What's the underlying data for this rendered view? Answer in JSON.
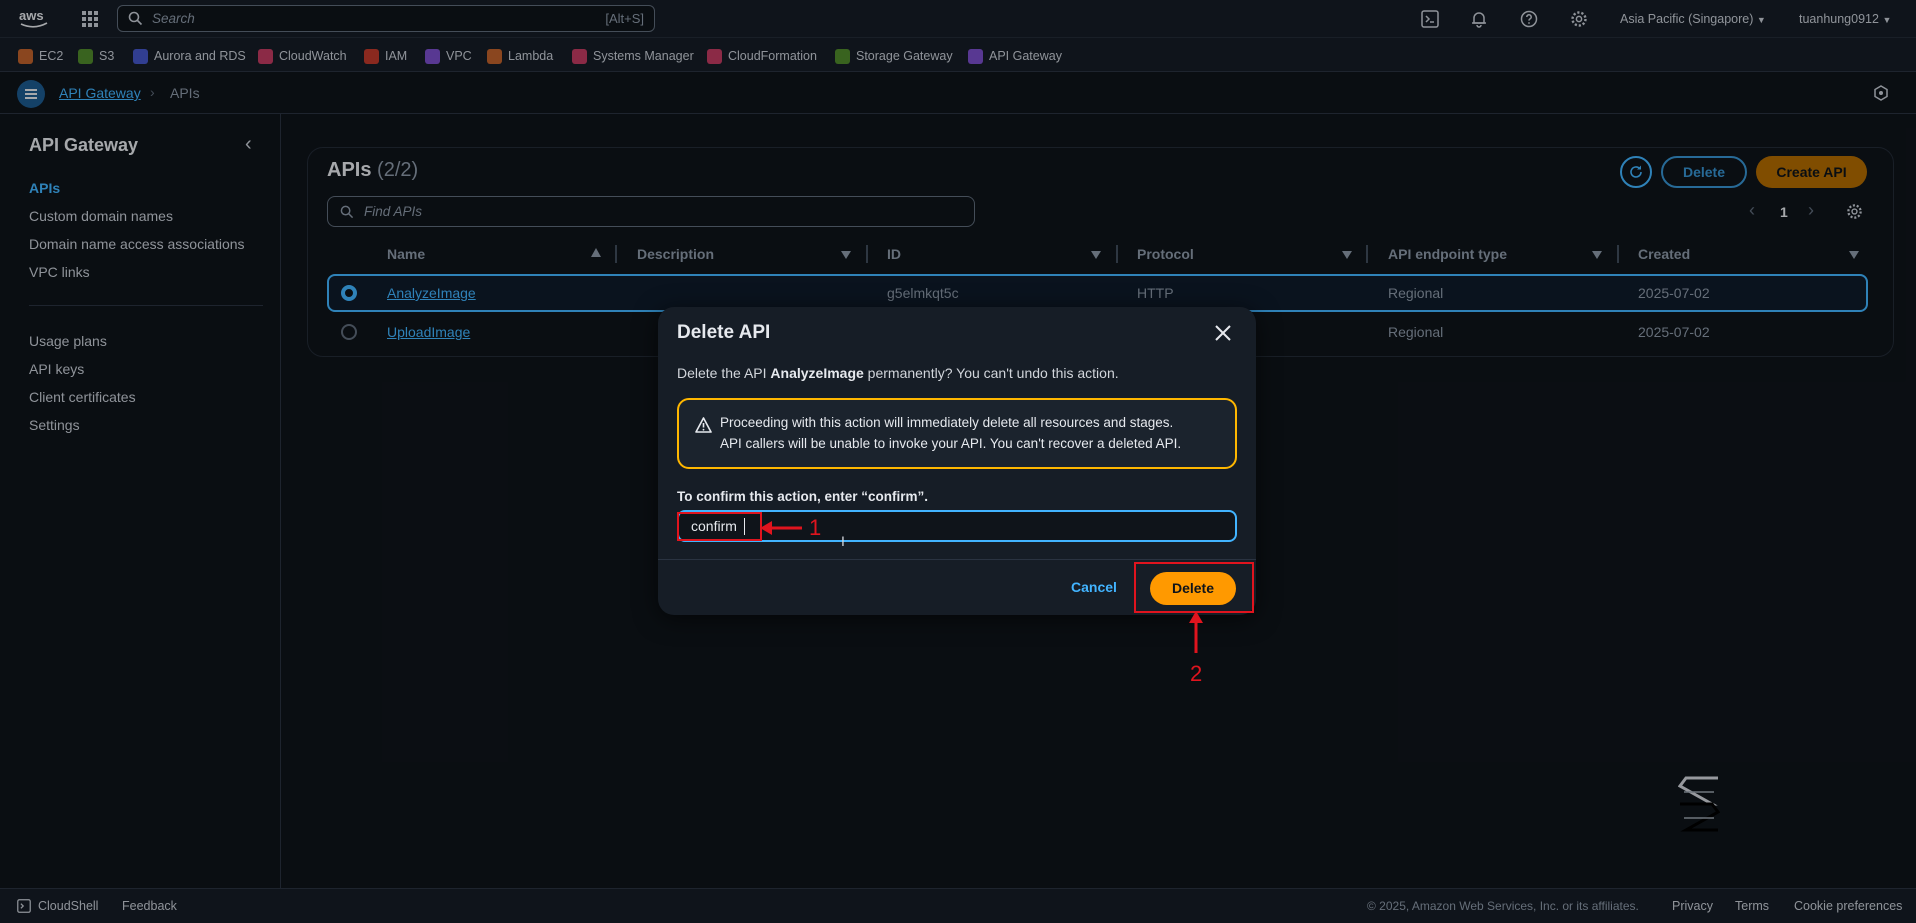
{
  "topbar": {
    "search_placeholder": "Search",
    "shortcut": "[Alt+S]",
    "region": "Asia Pacific (Singapore)",
    "user": "tuanhung0912"
  },
  "favorites": [
    {
      "label": "EC2",
      "color": "#c0612b"
    },
    {
      "label": "S3",
      "color": "#4f8a2b"
    },
    {
      "label": "Aurora and RDS",
      "color": "#4556c9"
    },
    {
      "label": "CloudWatch",
      "color": "#c13b62"
    },
    {
      "label": "IAM",
      "color": "#c0392b"
    },
    {
      "label": "VPC",
      "color": "#7b4ecb"
    },
    {
      "label": "Lambda",
      "color": "#c0612b"
    },
    {
      "label": "Systems Manager",
      "color": "#c13b62"
    },
    {
      "label": "CloudFormation",
      "color": "#c13b62"
    },
    {
      "label": "Storage Gateway",
      "color": "#4f8a2b"
    },
    {
      "label": "API Gateway",
      "color": "#7b4ecb"
    }
  ],
  "breadcrumb": {
    "root": "API Gateway",
    "current": "APIs"
  },
  "sidebar": {
    "title": "API Gateway",
    "items": [
      "APIs",
      "Custom domain names",
      "Domain name access associations",
      "VPC links"
    ],
    "items2": [
      "Usage plans",
      "API keys",
      "Client certificates",
      "Settings"
    ]
  },
  "apis": {
    "title": "APIs",
    "count": "(2/2)",
    "delete_label": "Delete",
    "create_label": "Create API",
    "search_placeholder": "Find APIs",
    "page": "1",
    "columns": [
      "Name",
      "Description",
      "ID",
      "Protocol",
      "API endpoint type",
      "Created"
    ],
    "rows": [
      {
        "name": "AnalyzeImage",
        "description": "",
        "id": "g5elmkqt5c",
        "protocol": "HTTP",
        "endpoint": "Regional",
        "created": "2025-07-02",
        "selected": true
      },
      {
        "name": "UploadImage",
        "description": "",
        "id": "",
        "protocol": "",
        "endpoint": "Regional",
        "created": "2025-07-02",
        "selected": false
      }
    ]
  },
  "modal": {
    "title": "Delete API",
    "desc_pre": "Delete the API ",
    "desc_name": "AnalyzeImage",
    "desc_post": " permanently? You can't undo this action.",
    "warning_line1": "Proceeding with this action will immediately delete all resources and stages.",
    "warning_line2": "API callers will be unable to invoke your API. You can't recover a deleted API.",
    "confirm_label": "To confirm this action, enter “confirm”.",
    "confirm_value": "confirm",
    "cancel_label": "Cancel",
    "delete_label": "Delete"
  },
  "annotations": {
    "step1": "1",
    "step2": "2"
  },
  "footer": {
    "cloudshell": "CloudShell",
    "feedback": "Feedback",
    "copyright": "© 2025, Amazon Web Services, Inc. or its affiliates.",
    "privacy": "Privacy",
    "terms": "Terms",
    "cookies": "Cookie preferences"
  },
  "colors": {
    "accent": "#ff9900",
    "link": "#42b4ff",
    "bg": "#0f141a",
    "panel": "#161d26"
  }
}
